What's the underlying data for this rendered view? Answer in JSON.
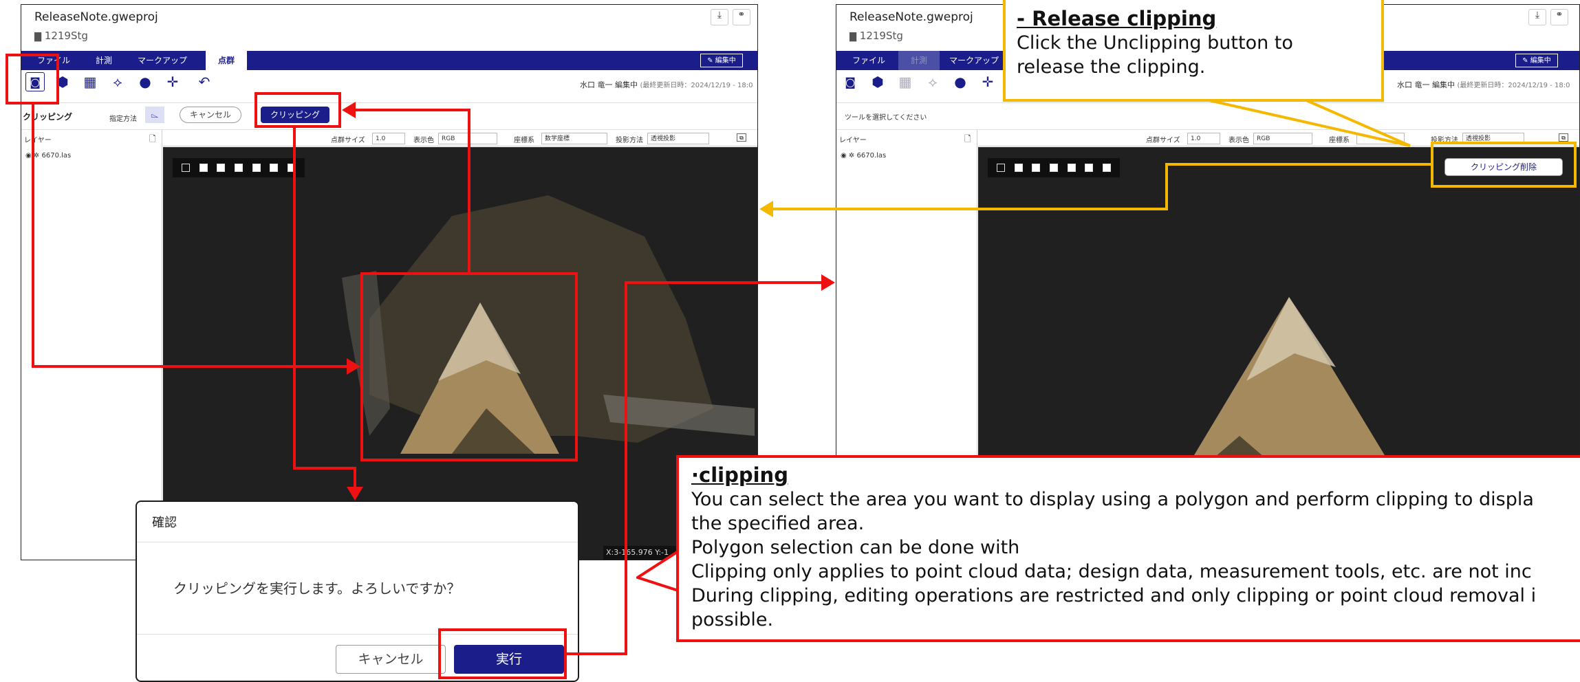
{
  "colors": {
    "accent": "#1a1d8a",
    "red": "#ee1111",
    "yellow": "#f5b800",
    "viewer": "#202020"
  },
  "left_window": {
    "file_name": "ReleaseNote.gweproj",
    "project": "1219Stg",
    "tabs": [
      {
        "label": "ファイル"
      },
      {
        "label": "計測"
      },
      {
        "label": "マークアップ"
      },
      {
        "label": "点群",
        "active": true
      }
    ],
    "edit_label": "✎ 編集中",
    "tool_icons": [
      "clip-icon",
      "polygon-select-icon",
      "box-select-icon",
      "layers-icon",
      "remove-points-icon",
      "point-icon",
      "undo-icon"
    ],
    "editor_status": "水口 竜一 編集中",
    "last_updated": "(最終更新日時：2024/12/19 - 18:0",
    "clip_bar": {
      "title": "クリッピング",
      "method_label": "指定方法",
      "cancel": "キャンセル",
      "clip": "クリッピング"
    },
    "viewer_bar": {
      "size_label": "点群サイズ",
      "size_value": "1.0",
      "color_label": "表示色",
      "color_value": "RGB",
      "coord_label": "座標系",
      "coord_value": "数学座標",
      "proj_label": "投影方法",
      "proj_value": "透視投影"
    },
    "layer_panel": {
      "title": "レイヤー",
      "item": "6670.las"
    },
    "coordinates": "X:3-165.976  Y:-1"
  },
  "right_window": {
    "file_name": "ReleaseNote.gweproj",
    "project": "1219Stg",
    "tabs": [
      {
        "label": "ファイル"
      },
      {
        "label": "計測",
        "disabled": true
      },
      {
        "label": "マークアップ"
      }
    ],
    "edit_label": "✎ 編集中",
    "editor_status": "水口 竜一 編集中",
    "last_updated": "(最終更新日時：2024/12/19 - 18:0",
    "hint": "ツールを選択してください",
    "viewer_bar": {
      "size_label": "点群サイズ",
      "size_value": "1.0",
      "color_label": "表示色",
      "color_value": "RGB",
      "coord_label": "座標系",
      "proj_label": "投影方法",
      "proj_value": "透視投影"
    },
    "layer_panel": {
      "title": "レイヤー",
      "item": "6670.las"
    },
    "unclip_button": "クリッピング削除"
  },
  "dialog": {
    "title": "確認",
    "message": "クリッピングを実行します。よろしいですか？",
    "cancel": "キャンセル",
    "confirm": "実行"
  },
  "callout_release": {
    "title": "- Release clipping",
    "lines": [
      "Click the Unclipping button to",
      "release the clipping."
    ]
  },
  "callout_clipping": {
    "title": "·clipping",
    "lines": [
      "You can select the area you want to display using a polygon and perform clipping to displa",
      "the specified area.",
      "Polygon selection can be done with",
      "Clipping only applies to point cloud data; design data, measurement tools, etc. are not inc",
      "During clipping, editing operations are restricted and only clipping or point cloud removal i",
      "possible."
    ]
  }
}
